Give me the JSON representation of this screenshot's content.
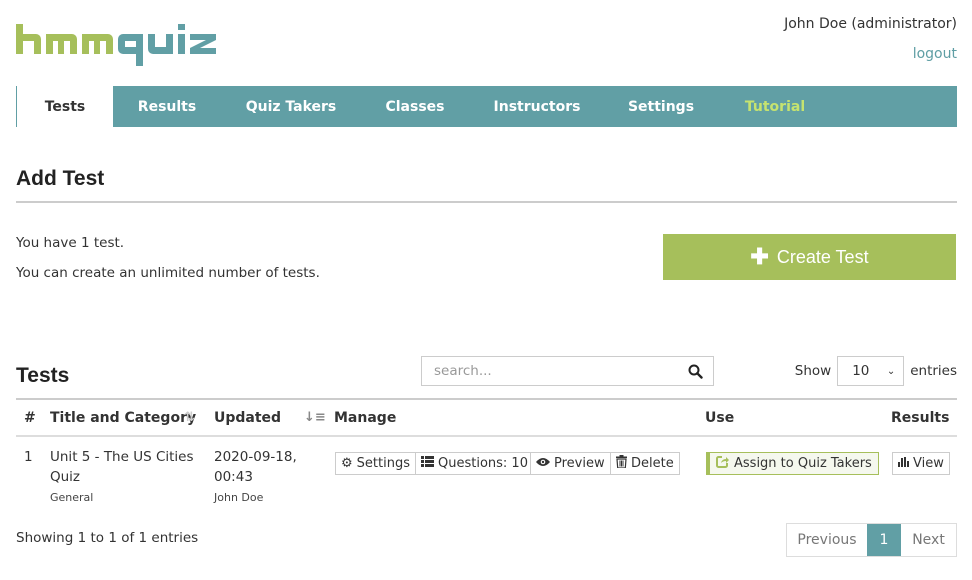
{
  "brand": {
    "logo_part1": "hmm",
    "logo_part2": "quiz",
    "color_green": "#a6bf5b",
    "color_teal": "#619fa5"
  },
  "user": {
    "name": "John Doe (administrator)",
    "logout_label": "logout"
  },
  "nav": {
    "items": [
      {
        "label": "Tests",
        "active": true
      },
      {
        "label": "Results"
      },
      {
        "label": "Quiz Takers"
      },
      {
        "label": "Classes"
      },
      {
        "label": "Instructors"
      },
      {
        "label": "Settings"
      },
      {
        "label": "Tutorial"
      }
    ]
  },
  "add_test": {
    "title": "Add Test",
    "info_count": "You have 1 test.",
    "info_limit": "You can create an unlimited number of tests.",
    "create_label": "Create Test",
    "create_icon": "plus-icon"
  },
  "tests": {
    "title": "Tests",
    "search": {
      "placeholder": "search...",
      "value": "",
      "icon": "search-icon"
    },
    "show_label": "Show",
    "entries_label": "entries",
    "page_size": "10",
    "columns": [
      "#",
      "Title and Category",
      "Updated",
      "Manage",
      "Use",
      "Results"
    ],
    "rows": [
      {
        "num": "1",
        "title": "Unit 5 - The US Cities Quiz",
        "category": "General",
        "updated_date": "2020-09-18,",
        "updated_time": "00:43",
        "updated_by": "John Doe",
        "manage": {
          "settings": "Settings",
          "questions": "Questions: 10",
          "preview": "Preview",
          "delete": "Delete"
        },
        "use_label": "Assign to Quiz Takers",
        "results_label": "View"
      }
    ],
    "footer_info": "Showing 1 to 1 of 1 entries",
    "pagination": {
      "previous": "Previous",
      "current": "1",
      "next": "Next"
    }
  }
}
